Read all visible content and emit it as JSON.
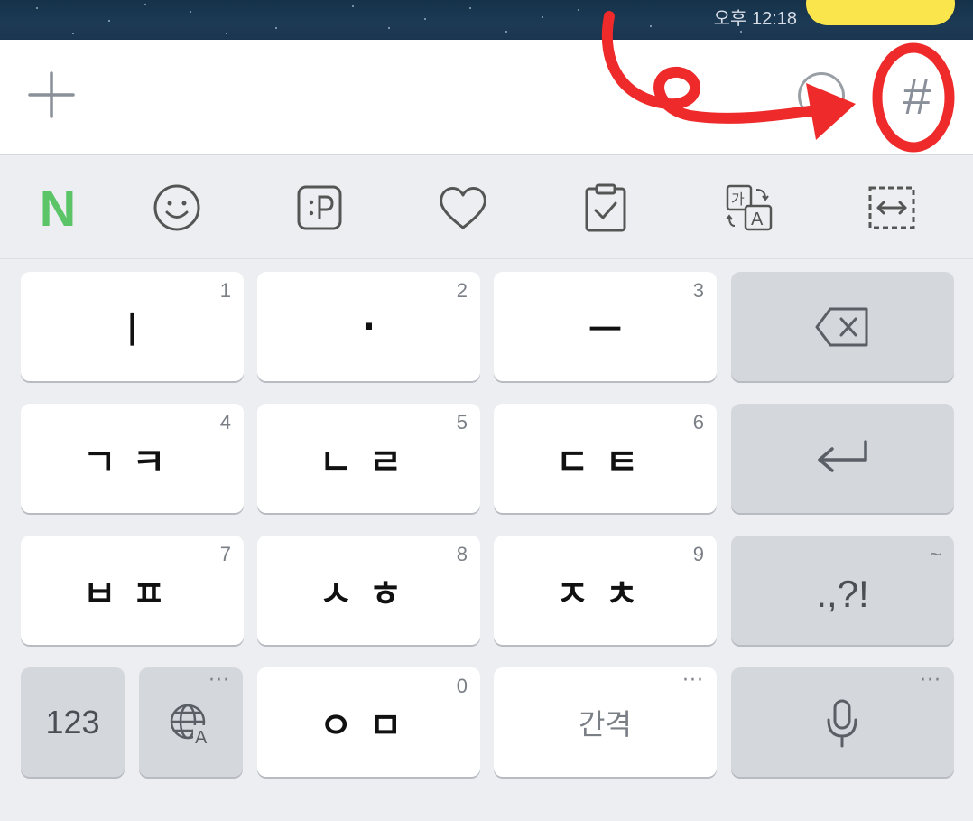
{
  "status": {
    "time": "오후 12:18"
  },
  "input_bar": {
    "hash_label": "#"
  },
  "toolbar": {
    "items": [
      {
        "icon": "naver-n-icon",
        "label": "N",
        "color": "#5ac467"
      },
      {
        "icon": "smiley-icon"
      },
      {
        "icon": "emoticon-p-icon"
      },
      {
        "icon": "heart-icon"
      },
      {
        "icon": "clipboard-icon"
      },
      {
        "icon": "translate-icon"
      },
      {
        "icon": "resize-icon"
      }
    ]
  },
  "keys": {
    "row1": [
      {
        "label": "ㅣ",
        "num": "1"
      },
      {
        "label": "·",
        "num": "2"
      },
      {
        "label": "ㅡ",
        "num": "3"
      }
    ],
    "row2": [
      {
        "label": "ㄱㅋ",
        "num": "4"
      },
      {
        "label": "ㄴㄹ",
        "num": "5"
      },
      {
        "label": "ㄷㅌ",
        "num": "6"
      }
    ],
    "row3": [
      {
        "label": "ㅂㅍ",
        "num": "7"
      },
      {
        "label": "ㅅㅎ",
        "num": "8"
      },
      {
        "label": "ㅈㅊ",
        "num": "9"
      },
      {
        "label": ".,?!",
        "num": "~"
      }
    ],
    "row4": {
      "numbers_label": "123",
      "zero": {
        "label": "ㅇㅁ",
        "num": "0"
      },
      "space_label": "간격",
      "more": "···"
    }
  },
  "colors": {
    "annotation_red": "#ef2a2a",
    "key_bg": "#ffffff",
    "function_key_bg": "#d4d7dc",
    "keyboard_bg": "#eceef1",
    "accent_yellow": "#fae64c"
  }
}
